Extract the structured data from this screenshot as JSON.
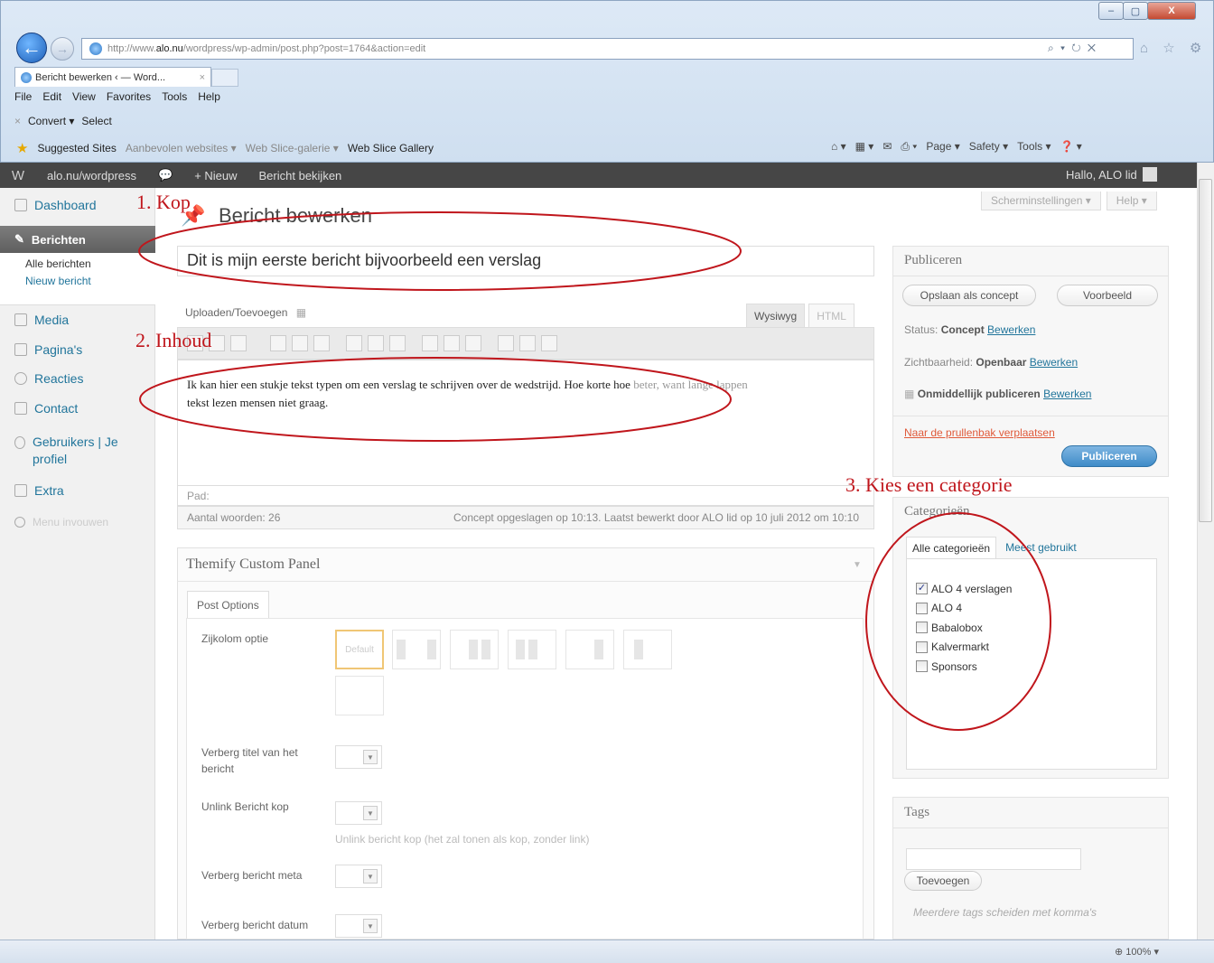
{
  "browser": {
    "url_prefix": "http://www.",
    "url_domain": "alo.nu",
    "url_rest": "/wordpress/wp-admin/post.php?post=1764&action=edit",
    "url_tools": "⌕ ▾ ↻ ✕",
    "home_icons": "⌂ ☆ ⚙",
    "tab_title": "Bericht bewerken ‹ — Word...",
    "tab_close": "×",
    "menu": [
      "File",
      "Edit",
      "View",
      "Favorites",
      "Tools",
      "Help"
    ],
    "convert_close": "×",
    "convert_label": "Convert",
    "convert_caret": "▾",
    "select_label": "Select",
    "favorites": {
      "suggested": "Suggested Sites",
      "aanbevolen": "Aanbevolen websites ▾",
      "webslice_galerie": "Web Slice-galerie ▾",
      "webslice_gallery": "Web Slice Gallery"
    },
    "command_bar": [
      "⌂ ▾",
      "▦ ▾",
      "✉",
      "⎙ ▾",
      "Page ▾",
      "Safety ▾",
      "Tools ▾",
      "❓ ▾"
    ],
    "window_buttons": [
      "–",
      "▢",
      "X"
    ],
    "zoom": "100%"
  },
  "adminbar": {
    "wp_logo": "W",
    "site": "alo.nu/wordpress",
    "comments_icon": "💬",
    "new": "+ Nieuw",
    "view_post": "Bericht bekijken",
    "greeting": "Hallo, ALO lid"
  },
  "sidebar": {
    "dashboard": "Dashboard",
    "posts": "Berichten",
    "all_posts": "Alle berichten",
    "new_post": "Nieuw bericht",
    "media": "Media",
    "pages": "Pagina's",
    "comments": "Reacties",
    "contact": "Contact",
    "users": "Gebruikers | Je profiel",
    "extra": "Extra",
    "collapse": "Menu invouwen"
  },
  "main": {
    "page_title": "Bericht bewerken",
    "screen_options": "Scherminstellingen ▾",
    "help": "Help ▾",
    "post_title": "Dit is mijn eerste bericht bijvoorbeeld een verslag",
    "upload_label": "Uploaden/Toevoegen",
    "tab_visual": "Wysiwyg",
    "tab_html": "HTML",
    "body_text": "Ik kan hier een stukje tekst typen om een verslag te schrijven over de wedstrijd. Hoe korte hoe ",
    "body_faded": "beter, want lange lappen",
    "body_line2": "tekst lezen mensen niet graag.",
    "path_label": "Pad:",
    "word_count": "Aantal woorden: 26",
    "saved_status": "Concept opgeslagen op 10:13. Laatst bewerkt door ALO lid op 10 juli 2012 om 10:10"
  },
  "themify": {
    "title": "Themify Custom Panel",
    "tab": "Post Options",
    "sidebar_option": "Zijkolom optie",
    "default_layout": "Default",
    "hide_title": "Verberg titel van het bericht",
    "unlink_title": "Unlink Bericht kop",
    "unlink_hint": "Unlink bericht kop (het zal tonen als kop, zonder link)",
    "hide_meta": "Verberg bericht meta",
    "hide_date": "Verberg bericht datum"
  },
  "publish": {
    "title": "Publiceren",
    "save_draft": "Opslaan als concept",
    "preview": "Voorbeeld",
    "status_label": "Status:",
    "status_value": "Concept",
    "visibility_label": "Zichtbaarheid:",
    "visibility_value": "Openbaar",
    "publish_immediately": "Onmiddellijk publiceren",
    "edit_link": "Bewerken",
    "trash": "Naar de prullenbak verplaatsen",
    "publish_button": "Publiceren"
  },
  "categories": {
    "title": "Categorieën",
    "tab_all": "Alle categorieën",
    "tab_popular": "Meest gebruikt",
    "items": [
      {
        "label": "ALO 4 verslagen",
        "checked": "✓"
      },
      {
        "label": "ALO 4",
        "checked": ""
      },
      {
        "label": "Babalobox",
        "checked": ""
      },
      {
        "label": "Kalvermarkt",
        "checked": ""
      },
      {
        "label": "Sponsors",
        "checked": ""
      }
    ]
  },
  "tags": {
    "title": "Tags",
    "add": "Toevoegen",
    "hint": "Meerdere tags scheiden met komma's"
  },
  "annotations": {
    "kop": "1. Kop",
    "inhoud": "2. Inhoud",
    "categorie": "3. Kies een categorie"
  },
  "colors": {
    "annotation": "#c0161c",
    "link": "#21759b",
    "adminbar": "#464646",
    "publish_button": "#3f8bc8"
  }
}
